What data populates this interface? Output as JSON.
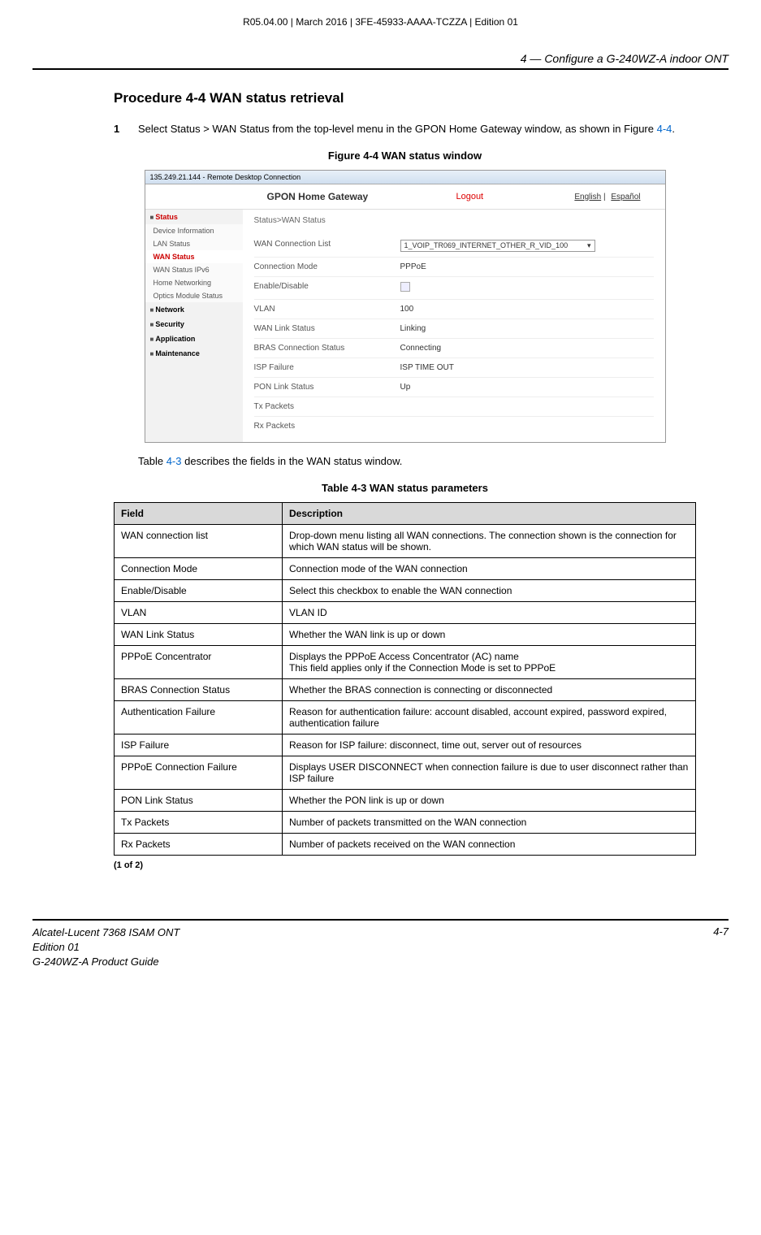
{
  "header": {
    "topline": "R05.04.00 | March 2016 | 3FE-45933-AAAA-TCZZA | Edition 01",
    "chapter": "4 —  Configure a G-240WZ-A indoor ONT"
  },
  "procedure": {
    "title": "Procedure 4-4  WAN status retrieval",
    "step_num": "1",
    "step_text_a": "Select Status > WAN Status from the top-level menu in the GPON Home Gateway window, as shown in Figure ",
    "step_text_ref": "4-4",
    "step_text_b": "."
  },
  "figure": {
    "caption": "Figure 4-4  WAN status window",
    "titlebar": "135.249.21.144 - Remote Desktop Connection",
    "header": {
      "title": "GPON Home Gateway",
      "logout": "Logout",
      "lang_en": "English",
      "lang_es": "Español"
    },
    "sidebar": {
      "status": "Status",
      "items": [
        "Device Information",
        "LAN Status",
        "WAN Status",
        "WAN Status IPv6",
        "Home Networking",
        "Optics Module Status"
      ],
      "groups": [
        "Network",
        "Security",
        "Application",
        "Maintenance"
      ]
    },
    "breadcrumb": "Status>WAN Status",
    "rows": [
      {
        "label": "WAN Connection List",
        "value": "1_VOIP_TR069_INTERNET_OTHER_R_VID_100",
        "type": "dropdown"
      },
      {
        "label": "Connection Mode",
        "value": "PPPoE"
      },
      {
        "label": "Enable/Disable",
        "value": "",
        "type": "checkbox"
      },
      {
        "label": "VLAN",
        "value": "100"
      },
      {
        "label": "WAN Link Status",
        "value": "Linking"
      },
      {
        "label": "BRAS Connection Status",
        "value": "Connecting"
      },
      {
        "label": "ISP Failure",
        "value": "ISP TIME OUT"
      },
      {
        "label": "PON Link Status",
        "value": "Up"
      },
      {
        "label": "Tx Packets",
        "value": ""
      },
      {
        "label": "Rx Packets",
        "value": ""
      }
    ]
  },
  "after_figure": {
    "pre": "Table ",
    "ref": "4-3",
    "post": " describes the fields in the WAN status window."
  },
  "table": {
    "caption": "Table 4-3 WAN status parameters",
    "head": {
      "field": "Field",
      "desc": "Description"
    },
    "rows": [
      {
        "field": "WAN connection list",
        "desc": "Drop-down menu listing all WAN connections. The connection shown is the connection for which WAN status will be shown."
      },
      {
        "field": "Connection Mode",
        "desc": "Connection mode of the WAN connection"
      },
      {
        "field": "Enable/Disable",
        "desc": "Select this checkbox to enable the WAN connection"
      },
      {
        "field": "VLAN",
        "desc": "VLAN ID"
      },
      {
        "field": "WAN Link Status",
        "desc": "Whether the WAN link is up or down"
      },
      {
        "field": "PPPoE Concentrator",
        "desc": "Displays the PPPoE Access Concentrator (AC) name\nThis field applies only if the Connection Mode is set to PPPoE"
      },
      {
        "field": "BRAS Connection Status",
        "desc": "Whether the BRAS connection is connecting or disconnected"
      },
      {
        "field": "Authentication Failure",
        "desc": "Reason for authentication failure: account disabled, account expired, password expired, authentication failure"
      },
      {
        "field": "ISP Failure",
        "desc": "Reason for ISP failure: disconnect, time out, server out of resources"
      },
      {
        "field": "PPPoE Connection Failure",
        "desc": "Displays USER DISCONNECT when connection failure is due to user disconnect rather than ISP failure"
      },
      {
        "field": "PON Link Status",
        "desc": "Whether the PON link is up or down"
      },
      {
        "field": "Tx Packets",
        "desc": "Number of packets transmitted on the WAN connection"
      },
      {
        "field": "Rx Packets",
        "desc": "Number of packets received on the WAN connection"
      }
    ],
    "pager": "(1 of 2)"
  },
  "footer": {
    "line1": "Alcatel-Lucent 7368 ISAM ONT",
    "line2": "Edition 01",
    "line3": "G-240WZ-A Product Guide",
    "page": "4-7"
  }
}
